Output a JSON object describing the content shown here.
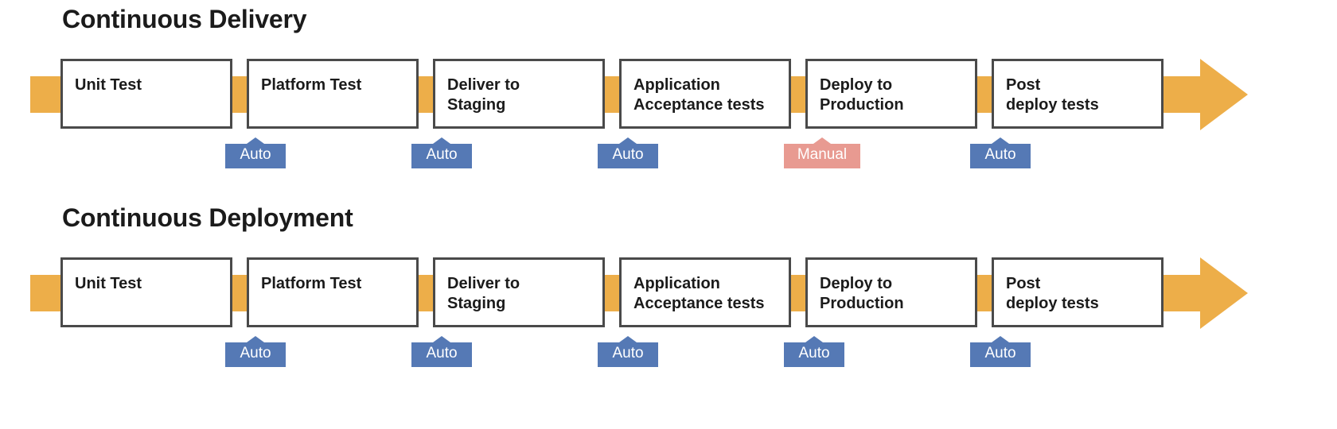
{
  "diagram": {
    "title_row_1": "Continuous Delivery",
    "title_row_2": "Continuous Deployment",
    "colors": {
      "orange": "#EDAE49",
      "auto_blue": "#5579B5",
      "manual_salmon": "#E89A91",
      "box_border": "#4A4A4A",
      "text": "#1B1B1B",
      "background": "#FFFFFF"
    }
  },
  "sections": [
    {
      "title": "Continuous Delivery",
      "stages": [
        {
          "label": "Unit Test"
        },
        {
          "label": "Platform Test"
        },
        {
          "label": "Deliver to\nStaging"
        },
        {
          "label": "Application\nAcceptance tests"
        },
        {
          "label": "Deploy to\nProduction"
        },
        {
          "label": "Post\ndeploy tests"
        }
      ],
      "gates": [
        {
          "label": "Auto",
          "kind": "auto"
        },
        {
          "label": "Auto",
          "kind": "auto"
        },
        {
          "label": "Auto",
          "kind": "auto"
        },
        {
          "label": "Manual",
          "kind": "manual"
        },
        {
          "label": "Auto",
          "kind": "auto"
        }
      ]
    },
    {
      "title": "Continuous Deployment",
      "stages": [
        {
          "label": "Unit Test"
        },
        {
          "label": "Platform Test"
        },
        {
          "label": "Deliver to\nStaging"
        },
        {
          "label": "Application\nAcceptance tests"
        },
        {
          "label": "Deploy to\nProduction"
        },
        {
          "label": "Post\ndeploy tests"
        }
      ],
      "gates": [
        {
          "label": "Auto",
          "kind": "auto"
        },
        {
          "label": "Auto",
          "kind": "auto"
        },
        {
          "label": "Auto",
          "kind": "auto"
        },
        {
          "label": "Auto",
          "kind": "auto"
        },
        {
          "label": "Auto",
          "kind": "auto"
        }
      ]
    }
  ]
}
